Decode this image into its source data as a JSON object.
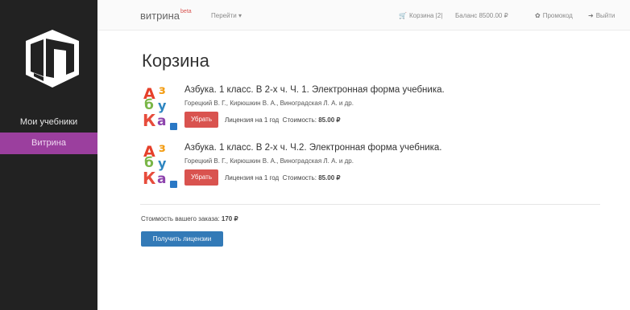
{
  "sidebar": {
    "items": [
      {
        "label": "Мои учебники"
      },
      {
        "label": "Витрина"
      }
    ]
  },
  "header": {
    "brand": "витрина",
    "brand_badge": "beta",
    "goto": "Перейти",
    "cart": "Корзина |2|",
    "balance": "Баланс 8500.00 ₽",
    "promo": "Промокод",
    "logout": "Выйти"
  },
  "main": {
    "title": "Корзина",
    "cart_items": [
      {
        "title": "Азбука. 1 класс. В 2-х ч. Ч. 1. Электронная форма учебника.",
        "authors": "Горецкий В. Г., Кирюшкин В. А., Виноградская Л. А. и др.",
        "remove_label": "Убрать",
        "license": "Лицензия на 1 год",
        "cost_label": "Стоимость:",
        "cost_value": "85.00 ₽"
      },
      {
        "title": "Азбука. 1 класс. В 2-х ч. Ч.2. Электронная форма учебника.",
        "authors": "Горецкий В. Г., Кирюшкин В. А., Виноградская Л. А. и др.",
        "remove_label": "Убрать",
        "license": "Лицензия на 1 год",
        "cost_label": "Стоимость:",
        "cost_value": "85.00 ₽"
      }
    ],
    "order_total_label": "Стоимость вашего заказа:",
    "order_total_value": "170 ₽",
    "get_licenses": "Получить лицензии"
  },
  "cover_letters": [
    "А",
    "з",
    "б",
    "у",
    "К",
    "а"
  ],
  "colors": {
    "sidebar_bg": "#222222",
    "active_item": "#9b3f9e",
    "remove_button": "#d9534f",
    "primary_button": "#337ab7"
  },
  "icons": [
    "logo-ip-icon",
    "caret-down-icon",
    "cart-icon",
    "ruble-icon",
    "gift-icon",
    "logout-icon",
    "book-cover-icon"
  ]
}
